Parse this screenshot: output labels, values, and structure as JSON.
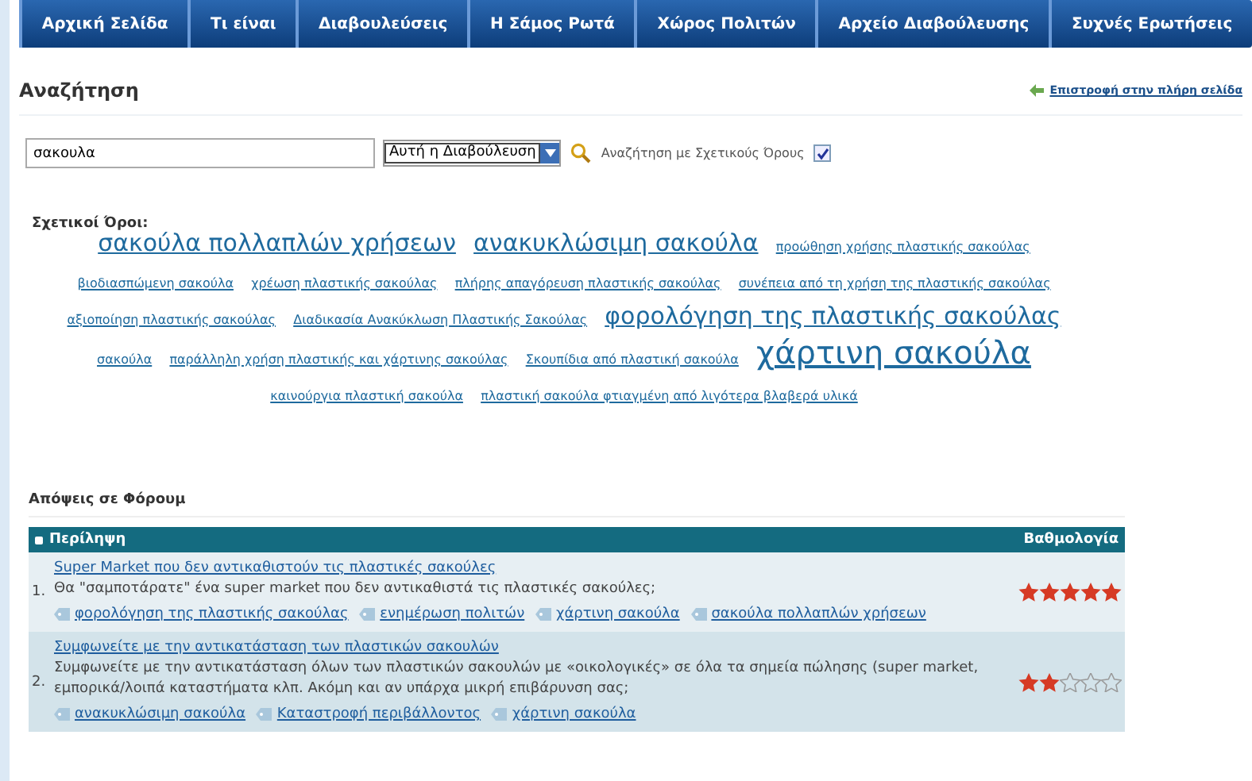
{
  "nav": [
    {
      "label": "Αρχική Σελίδα",
      "selected": false
    },
    {
      "label": "Τι είναι",
      "selected": false
    },
    {
      "label": "Διαβουλεύσεις",
      "selected": false
    },
    {
      "label": "Η Σάμος Ρωτά",
      "selected": false
    },
    {
      "label": "Χώρος Πολιτών",
      "selected": false
    },
    {
      "label": "Αρχείο Διαβούλευσης",
      "selected": false
    },
    {
      "label": "Συχνές Ερωτήσεις",
      "selected": false
    }
  ],
  "heading": "Αναζήτηση",
  "back_link": "Επιστροφή στην πλήρη σελίδα",
  "search": {
    "value": "σακουλα",
    "scope": "Αυτή η Διαβούλευση",
    "related_label": "Αναζήτηση με Σχετικούς Όρους",
    "related_checked": true
  },
  "related_terms": {
    "label": "Σχετικοί Όροι:",
    "tags": [
      {
        "text": "σακούλα πολλαπλών χρήσεων",
        "kind": "large"
      },
      {
        "text": "ανακυκλώσιμη σακούλα",
        "kind": "large"
      },
      {
        "text": "προώθηση χρήσης πλαστικής σακούλας",
        "kind": "small"
      },
      {
        "text": "βιοδιασπώμενη σακούλα",
        "kind": "small"
      },
      {
        "text": "χρέωση πλαστικής σακούλας",
        "kind": "small"
      },
      {
        "text": "πλήρης απαγόρευση πλαστικής σακούλας",
        "kind": "small"
      },
      {
        "text": "συνέπεια από τη χρήση της πλαστικής σακούλας",
        "kind": "small"
      },
      {
        "text": "αξιοποίηση πλαστικής σακούλας",
        "kind": "small"
      },
      {
        "text": "Διαδικασία Ανακύκλωση Πλαστικής Σακούλας",
        "kind": "small"
      },
      {
        "text": "φορολόγηση της πλαστικής σακούλας",
        "kind": "large"
      },
      {
        "text": "σακούλα",
        "kind": "small"
      },
      {
        "text": "παράλληλη χρήση πλαστικής και χάρτινης σακούλας",
        "kind": "small"
      },
      {
        "text": "Σκουπίδια από πλαστική σακούλα",
        "kind": "small"
      },
      {
        "text": "χάρτινη σακούλα",
        "kind": "huge"
      },
      {
        "text": "καινούργια πλαστική σακούλα",
        "kind": "small"
      },
      {
        "text": "πλαστική σακούλα φτιαγμένη από λιγότερα βλαβερά υλικά",
        "kind": "small"
      }
    ]
  },
  "forum": {
    "title": "Απόψεις σε Φόρουμ",
    "columns": [
      "Περίληψη",
      "Βαθμολογία"
    ],
    "rows": [
      {
        "number": "1.",
        "title": "Super Market που δεν αντικαθιστούν τις πλαστικές σακούλες",
        "summary": "Θα \"σαμποτάρατε\" ένα super market που δεν αντικαθιστά τις πλαστικές σακούλες;",
        "tags": [
          "φορολόγηση της πλαστικής σακούλας",
          "ενημέρωση πολιτών",
          "χάρτινη σακούλα",
          "σακούλα πολλαπλών χρήσεων"
        ],
        "stars": 5
      },
      {
        "number": "2.",
        "title": "Συμφωνείτε με την αντικατάσταση των πλαστικών σακουλών",
        "summary": "Συμφωνείτε με την αντικατάσταση όλων των πλαστικών σακουλών με «οικολογικές» σε όλα τα σημεία πώλησης (super market, εμπορικά/λοιπά καταστήματα κλπ. Ακόμη και αν υπάρχα μικρή επιβάρυνση σας;",
        "tags": [
          "ανακυκλώσιμη σακούλα",
          "Καταστροφή περιβάλλοντος",
          "χάρτινη σακούλα"
        ],
        "stars": 2
      }
    ]
  }
}
